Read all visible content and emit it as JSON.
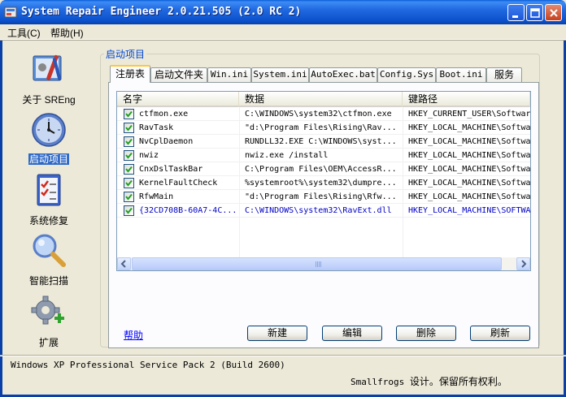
{
  "window": {
    "title": "System Repair Engineer 2.0.21.505 (2.0 RC 2)"
  },
  "menu": [
    {
      "label": "工具(C)"
    },
    {
      "label": "帮助(H)"
    }
  ],
  "nav": [
    {
      "label": "关于 SREng",
      "icon": "toolbox-icon"
    },
    {
      "label": "启动项目",
      "icon": "clock-icon",
      "selected": true
    },
    {
      "label": "系统修复",
      "icon": "checklist-icon"
    },
    {
      "label": "智能扫描",
      "icon": "magnifier-icon"
    },
    {
      "label": "扩展",
      "icon": "gear-plus-icon"
    }
  ],
  "group_title": "启动项目",
  "tabs": [
    {
      "label": "注册表",
      "active": true
    },
    {
      "label": "启动文件夹"
    },
    {
      "label": "Win.ini"
    },
    {
      "label": "System.ini"
    },
    {
      "label": "AutoExec.bat"
    },
    {
      "label": "Config.Sys"
    },
    {
      "label": "Boot.ini"
    },
    {
      "label": "服务"
    }
  ],
  "table": {
    "columns": [
      "名字",
      "数据",
      "键路径"
    ],
    "rows": [
      {
        "checked": true,
        "name": "ctfmon.exe",
        "data": "C:\\WINDOWS\\system32\\ctfmon.exe",
        "key": "HKEY_CURRENT_USER\\Softwar"
      },
      {
        "checked": true,
        "name": "RavTask",
        "data": "\"d:\\Program Files\\Rising\\Rav...",
        "key": "HKEY_LOCAL_MACHINE\\Softwa"
      },
      {
        "checked": true,
        "name": "NvCplDaemon",
        "data": "RUNDLL32.EXE C:\\WINDOWS\\syst...",
        "key": "HKEY_LOCAL_MACHINE\\Softwa"
      },
      {
        "checked": true,
        "name": "nwiz",
        "data": "nwiz.exe /install",
        "key": "HKEY_LOCAL_MACHINE\\Softwa"
      },
      {
        "checked": true,
        "name": "CnxDslTaskBar",
        "data": "C:\\Program Files\\OEM\\AccessR...",
        "key": "HKEY_LOCAL_MACHINE\\Softwa"
      },
      {
        "checked": true,
        "name": "KernelFaultCheck",
        "data": "%systemroot%\\system32\\dumpre...",
        "key": "HKEY_LOCAL_MACHINE\\Softwa"
      },
      {
        "checked": true,
        "name": "RfwMain",
        "data": "\"d:\\Program Files\\Rising\\Rfw...",
        "key": "HKEY_LOCAL_MACHINE\\Softwa"
      },
      {
        "checked": true,
        "name": "{32CD708B-60A7-4C...",
        "data": "C:\\WINDOWS\\system32\\RavExt.dll",
        "key": "HKEY_LOCAL_MACHINE\\SOFTWA",
        "highlight": true
      }
    ]
  },
  "actions": {
    "help": "帮助",
    "new": "新建",
    "edit": "编辑",
    "delete": "删除",
    "refresh": "刷新"
  },
  "status": {
    "os": "Windows XP Professional Service Pack 2 (Build 2600)",
    "copyright_en": "Smallfrogs ",
    "copyright_cn": "设计。保留所有权利。"
  },
  "colors": {
    "titlebar": "#0A4FC9",
    "selection": "#316AC5",
    "group_title": "#0046D5",
    "link": "#0000FF",
    "highlight_row": "#0000C8"
  }
}
